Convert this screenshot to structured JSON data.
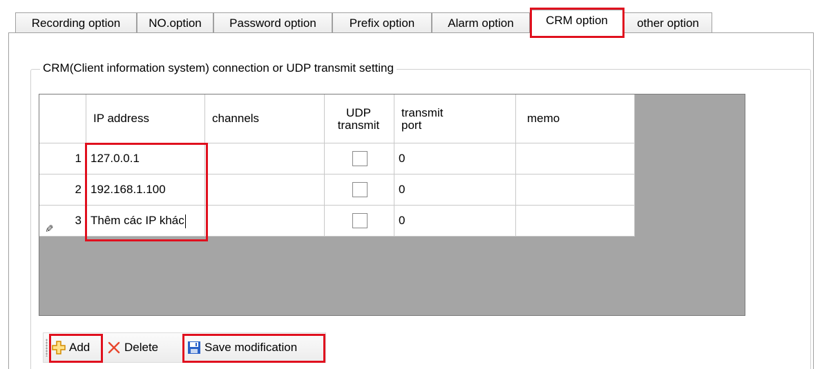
{
  "tabs": [
    {
      "label": "Recording option"
    },
    {
      "label": "NO.option"
    },
    {
      "label": "Password option"
    },
    {
      "label": "Prefix option"
    },
    {
      "label": "Alarm option"
    },
    {
      "label": "CRM option"
    },
    {
      "label": "other option"
    }
  ],
  "active_tab": "CRM option",
  "group": {
    "title": "CRM(Client information system) connection or UDP transmit setting"
  },
  "grid": {
    "columns": [
      {
        "label": ""
      },
      {
        "label": "IP address"
      },
      {
        "label": "channels"
      },
      {
        "label": "UDP transmit"
      },
      {
        "label": "transmit port"
      },
      {
        "label": "memo"
      }
    ],
    "rows": [
      {
        "num": "1",
        "ip": "127.0.0.1",
        "channels": "",
        "udp_transmit": false,
        "port": "0",
        "memo": ""
      },
      {
        "num": "2",
        "ip": "192.168.1.100",
        "channels": "",
        "udp_transmit": false,
        "port": "0",
        "memo": ""
      },
      {
        "num": "3",
        "ip": "Thêm các IP khác",
        "channels": "",
        "udp_transmit": false,
        "port": "0",
        "memo": "",
        "editing": true
      }
    ]
  },
  "toolbar": {
    "add_label": "Add",
    "delete_label": "Delete",
    "save_label": "Save modification"
  },
  "colors": {
    "highlight": "#e0101e",
    "grid_background": "#a5a5a5"
  },
  "icons": {
    "add": "plus-icon",
    "delete": "x-icon",
    "save": "floppy-disk-icon",
    "editing_row": "pencil-icon"
  }
}
